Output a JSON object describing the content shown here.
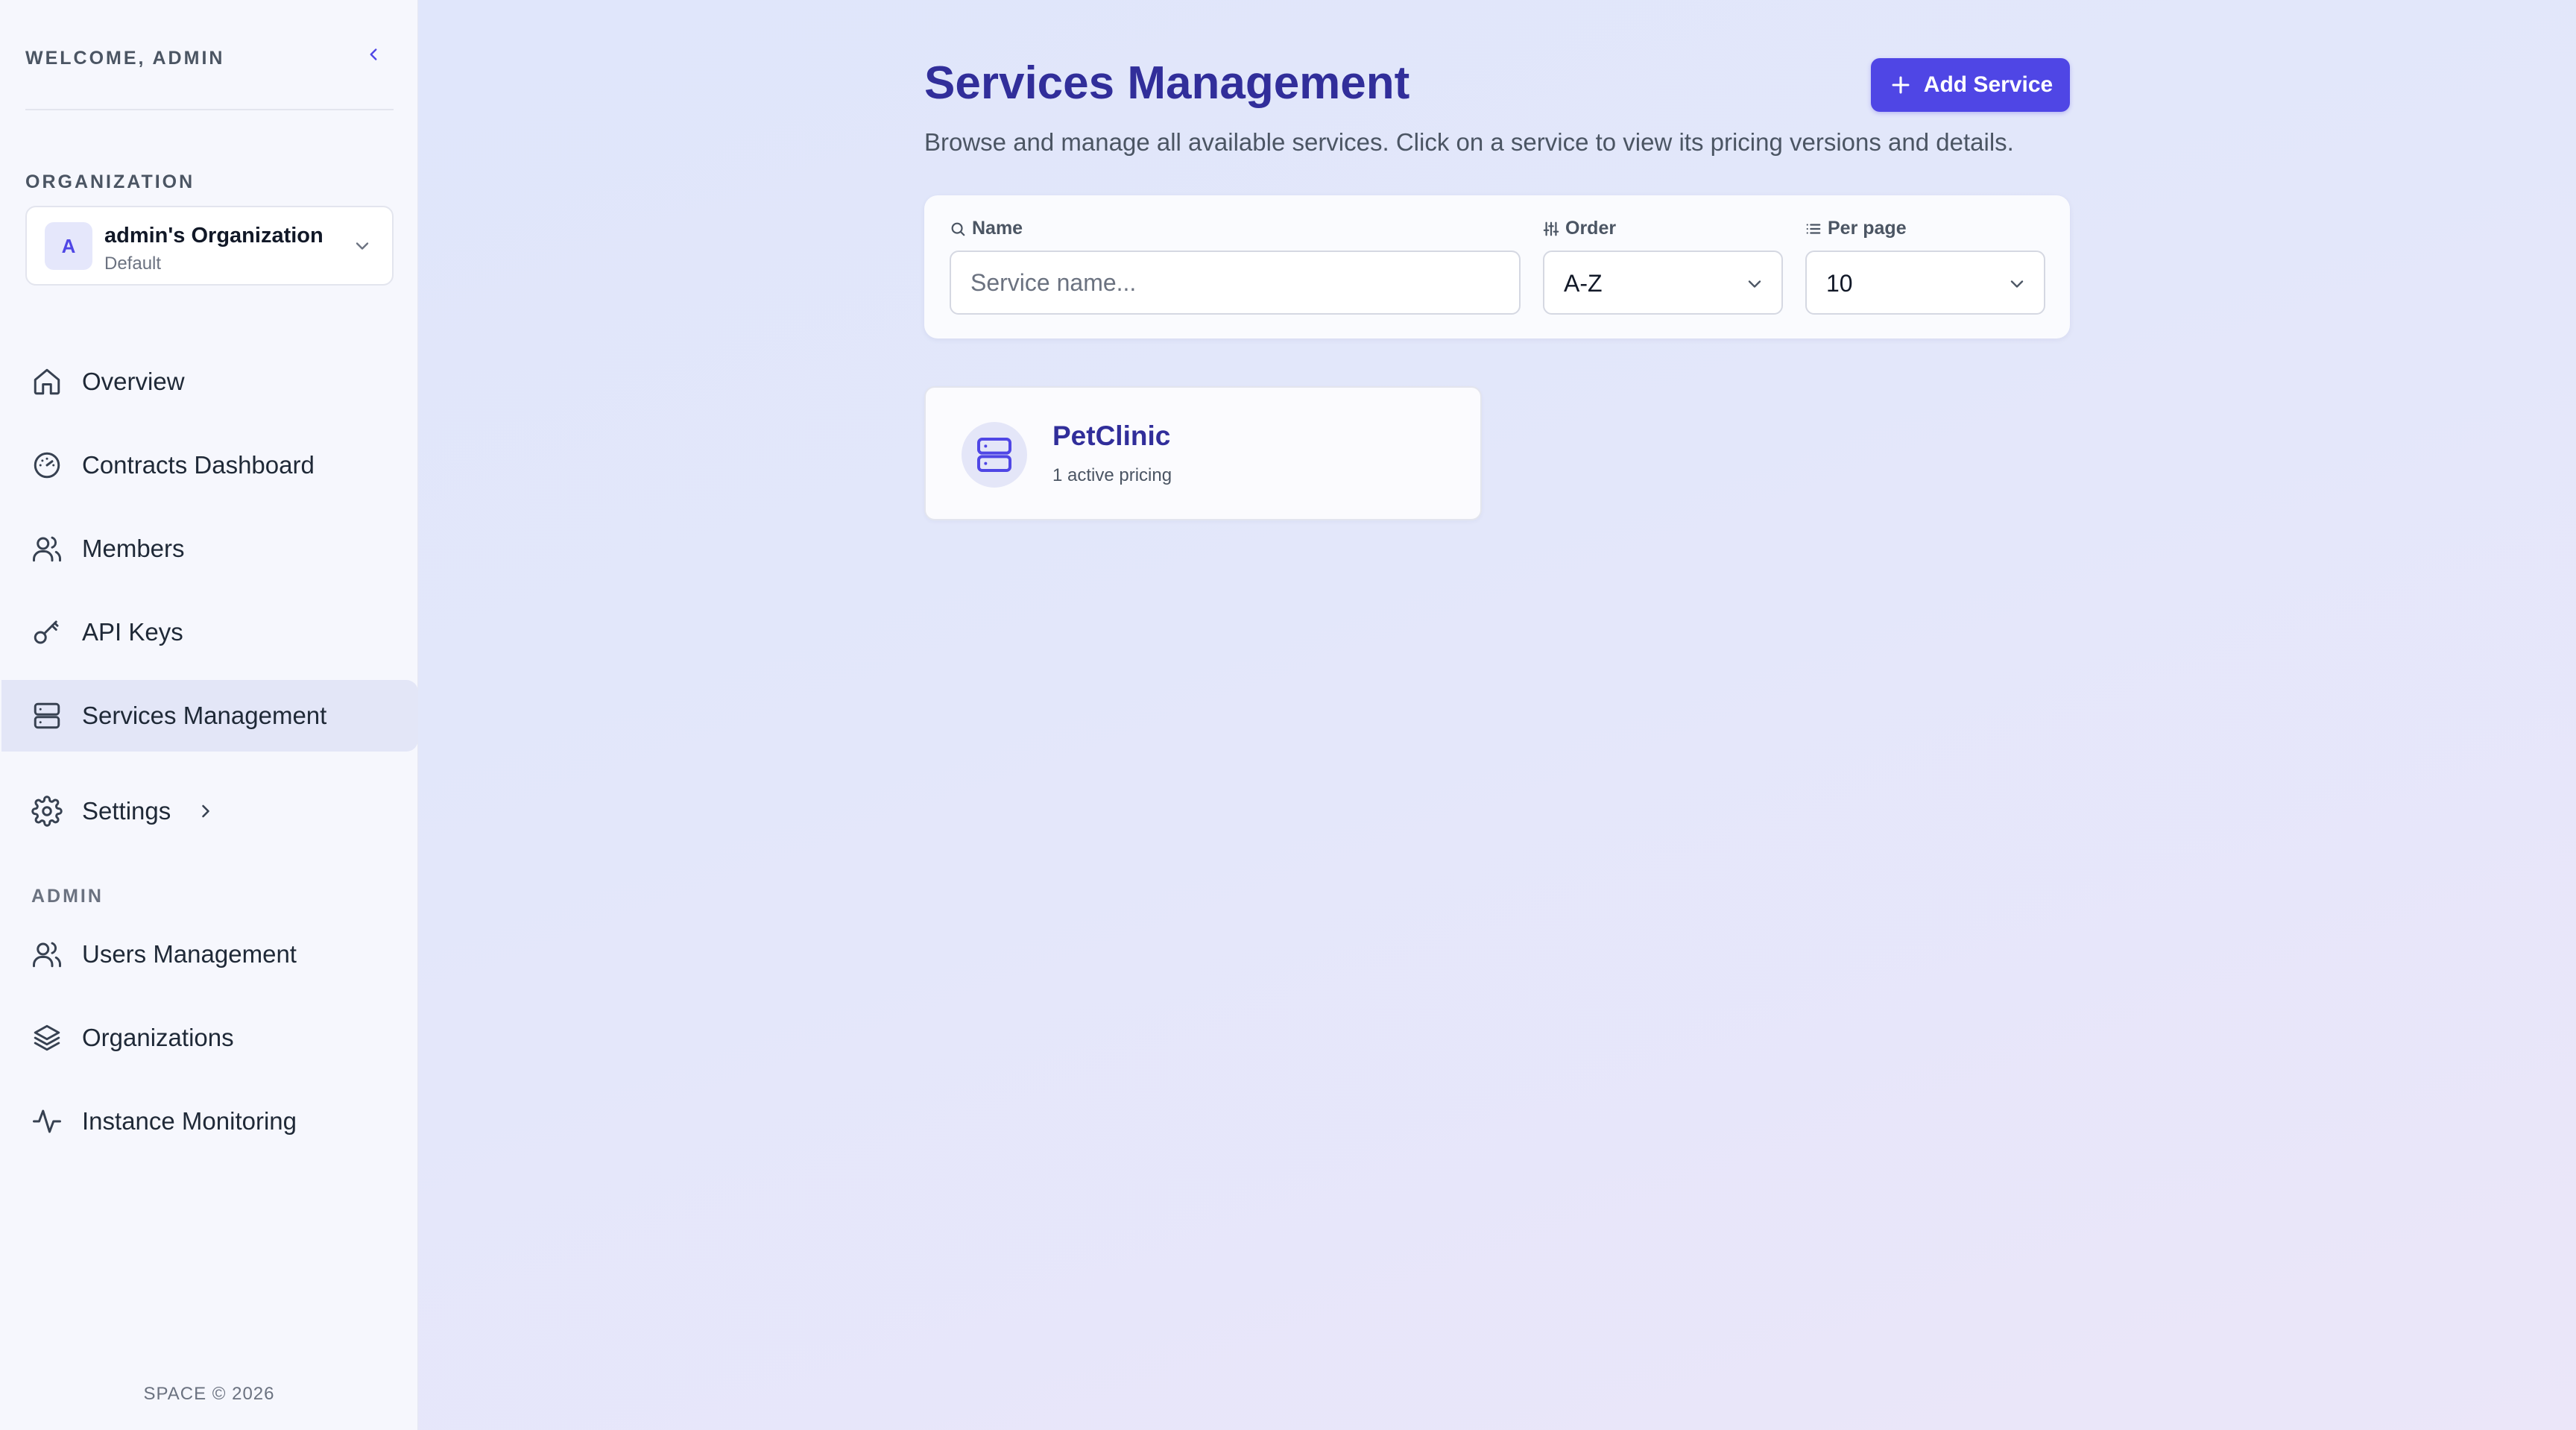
{
  "sidebar": {
    "welcome": "WELCOME, ADMIN",
    "organization_label": "ORGANIZATION",
    "organization": {
      "avatar_letter": "A",
      "name": "admin's Organization",
      "subtitle": "Default"
    },
    "nav": [
      {
        "label": "Overview",
        "icon": "home-icon"
      },
      {
        "label": "Contracts Dashboard",
        "icon": "gauge-icon"
      },
      {
        "label": "Members",
        "icon": "users-icon"
      },
      {
        "label": "API Keys",
        "icon": "key-icon"
      },
      {
        "label": "Services Management",
        "icon": "server-icon",
        "active": true
      },
      {
        "label": "Settings",
        "icon": "gear-icon"
      }
    ],
    "admin_label": "ADMIN",
    "admin_nav": [
      {
        "label": "Users Management",
        "icon": "users-icon"
      },
      {
        "label": "Organizations",
        "icon": "layers-icon"
      },
      {
        "label": "Instance Monitoring",
        "icon": "activity-icon"
      }
    ],
    "footer": "SPACE © 2026"
  },
  "main": {
    "title": "Services Management",
    "subtitle": "Browse and manage all available services. Click on a service to view its pricing versions and details.",
    "add_button": "Add Service",
    "filters": {
      "name_label": "Name",
      "name_placeholder": "Service name...",
      "order_label": "Order",
      "order_value": "A-Z",
      "per_page_label": "Per page",
      "per_page_value": "10"
    },
    "services": [
      {
        "name": "PetClinic",
        "meta": "1 active pricing",
        "icon": "server-icon"
      }
    ]
  },
  "colors": {
    "accent": "#4f46e5",
    "title": "#312e9a",
    "active_nav_bg": "#e3e6f7"
  }
}
